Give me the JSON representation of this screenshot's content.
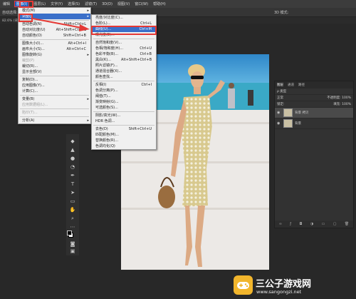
{
  "menubar": {
    "items": [
      "编辑",
      "图像(I)",
      "图层(L)",
      "文字(Y)",
      "选择(S)",
      "滤镜(T)",
      "3D(D)",
      "视图(V)",
      "窗口(W)",
      "帮助(H)"
    ]
  },
  "options": {
    "left": "自动选择:",
    "right": "3D 模式:"
  },
  "doc_tab": "82.6% (背景",
  "image_menu": {
    "items": [
      {
        "label": "模式(M)",
        "shortcut": "",
        "arrow": true
      },
      {
        "label": "调整(J)",
        "shortcut": "",
        "arrow": true
      },
      {
        "label": "自动色调(N)",
        "shortcut": "Shift+Ctrl+L"
      },
      {
        "label": "自动对比度(U)",
        "shortcut": "Alt+Shift+Ctrl+L"
      },
      {
        "label": "自动颜色(O)",
        "shortcut": "Shift+Ctrl+B"
      },
      {
        "label": "图像大小(I)...",
        "shortcut": "Alt+Ctrl+I"
      },
      {
        "label": "画布大小(S)...",
        "shortcut": "Alt+Ctrl+C"
      },
      {
        "label": "图像旋转(G)",
        "shortcut": "",
        "arrow": true
      },
      {
        "label": "裁剪(P)",
        "shortcut": ""
      },
      {
        "label": "裁切(R)...",
        "shortcut": ""
      },
      {
        "label": "显示全部(V)",
        "shortcut": ""
      },
      {
        "label": "复制(D)...",
        "shortcut": ""
      },
      {
        "label": "应用图像(Y)...",
        "shortcut": ""
      },
      {
        "label": "计算(C)...",
        "shortcut": ""
      },
      {
        "label": "变量(B)",
        "shortcut": "",
        "arrow": true
      },
      {
        "label": "应用数据组(L)...",
        "shortcut": ""
      },
      {
        "label": "陷印(T)...",
        "shortcut": ""
      },
      {
        "label": "分析(A)",
        "shortcut": "",
        "arrow": true
      }
    ]
  },
  "adjust_menu": {
    "items": [
      {
        "label": "亮度/对比度(C)...",
        "shortcut": ""
      },
      {
        "label": "色阶(L)...",
        "shortcut": "Ctrl+L"
      },
      {
        "label": "曲线(U)...",
        "shortcut": "Ctrl+M"
      },
      {
        "label": "曝光度(E)...",
        "shortcut": ""
      },
      {
        "label": "自然饱和度(V)...",
        "shortcut": ""
      },
      {
        "label": "色相/饱和度(H)...",
        "shortcut": "Ctrl+U"
      },
      {
        "label": "色彩平衡(B)...",
        "shortcut": "Ctrl+B"
      },
      {
        "label": "黑白(K)...",
        "shortcut": "Alt+Shift+Ctrl+B"
      },
      {
        "label": "照片滤镜(F)...",
        "shortcut": ""
      },
      {
        "label": "通道混合器(X)...",
        "shortcut": ""
      },
      {
        "label": "颜色查找...",
        "shortcut": ""
      },
      {
        "label": "反相(I)",
        "shortcut": "Ctrl+I"
      },
      {
        "label": "色调分离(P)...",
        "shortcut": ""
      },
      {
        "label": "阈值(T)...",
        "shortcut": ""
      },
      {
        "label": "渐变映射(G)...",
        "shortcut": ""
      },
      {
        "label": "可选颜色(S)...",
        "shortcut": ""
      },
      {
        "label": "阴影/高光(W)...",
        "shortcut": ""
      },
      {
        "label": "HDR 色调...",
        "shortcut": ""
      },
      {
        "label": "去色(D)",
        "shortcut": "Shift+Ctrl+U"
      },
      {
        "label": "匹配颜色(M)...",
        "shortcut": ""
      },
      {
        "label": "替换颜色(R)...",
        "shortcut": ""
      },
      {
        "label": "色调均化(Q)",
        "shortcut": ""
      }
    ]
  },
  "layers_panel": {
    "tabs": [
      "图层",
      "通道",
      "路径"
    ],
    "kind_label": "ρ 类型",
    "blend_mode": "正常",
    "opacity_label": "不透明度: 100%",
    "lock_label": "锁定:",
    "fill_label": "填充: 100%",
    "layers": [
      {
        "name": "背景 拷贝",
        "selected": true
      },
      {
        "name": "背景",
        "selected": false
      }
    ]
  },
  "watermark": {
    "title": "三公子游戏网",
    "url": "www.sangongzi.net"
  },
  "colors": {
    "highlight": "#3a6fc9",
    "annotation": "#e53935",
    "brand": "#f1b52c"
  }
}
